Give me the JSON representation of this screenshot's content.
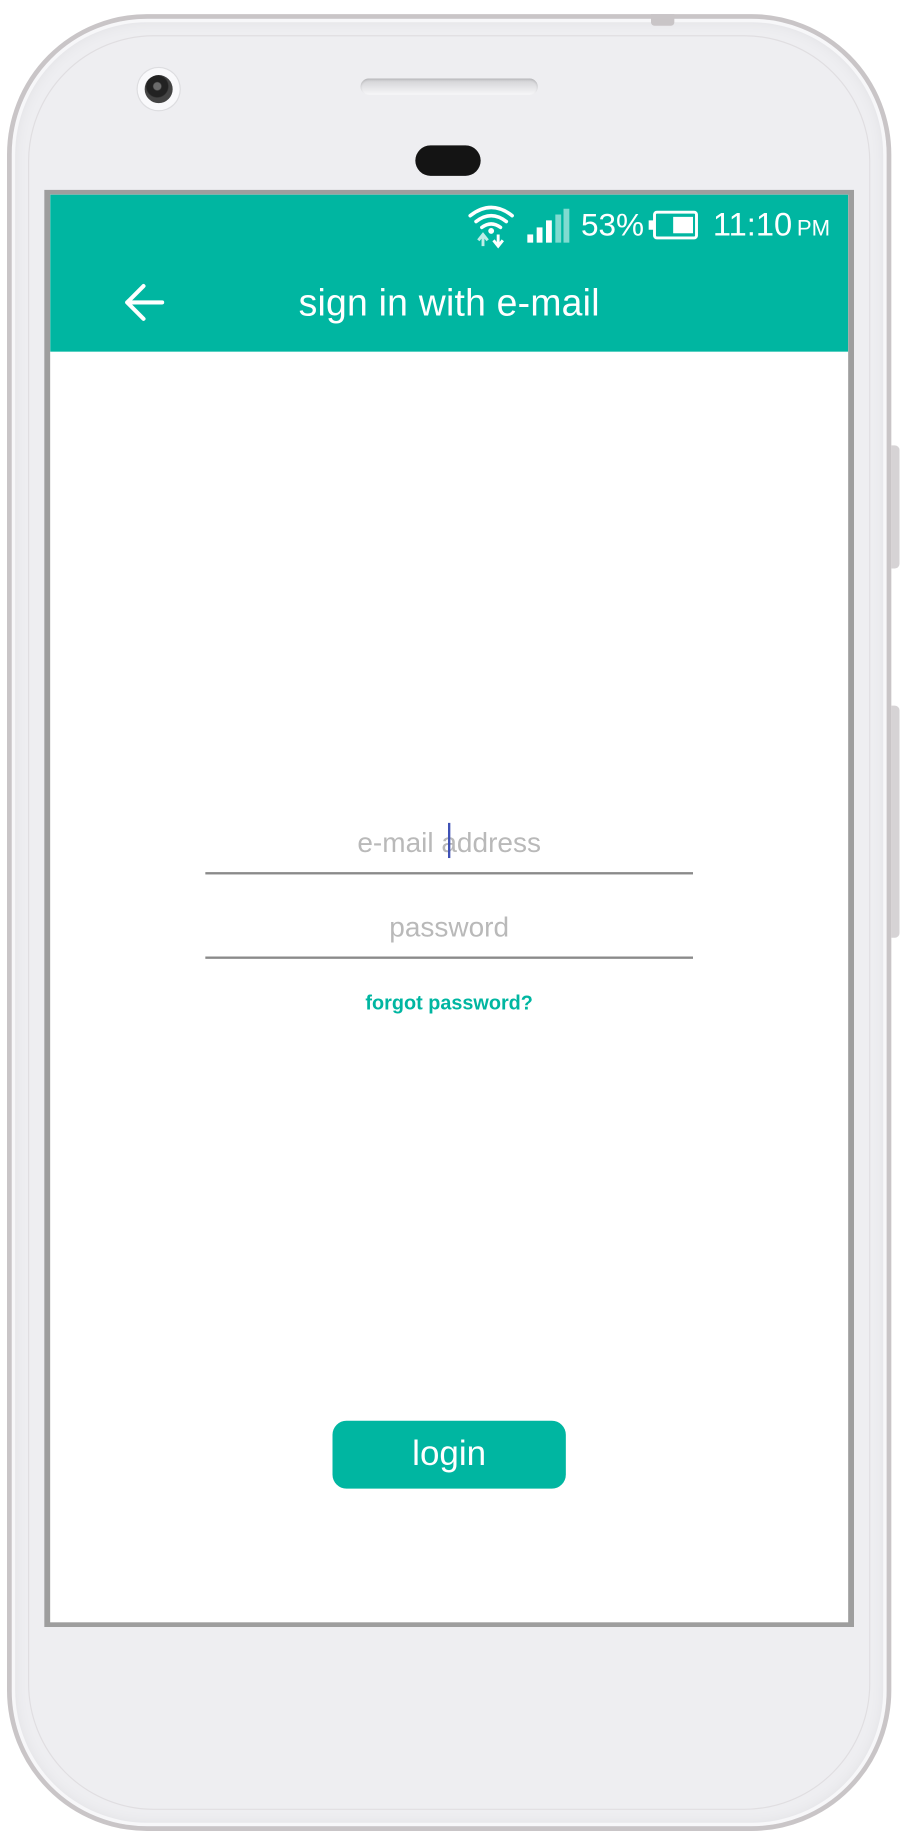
{
  "colors": {
    "accent": "#00b6a1",
    "placeholder": "#b9b9b9",
    "caret": "#3f51b5",
    "device_body": "#eeeef1"
  },
  "status_bar": {
    "wifi_icon": "wifi-icon",
    "signal_icon": "signal-icon",
    "battery_percent": "53%",
    "battery_icon": "battery-icon",
    "time": "11:10",
    "ampm": "PM"
  },
  "app_bar": {
    "back_icon": "arrow-left-icon",
    "title": "sign in with e-mail"
  },
  "form": {
    "email": {
      "placeholder": "e-mail address",
      "value": ""
    },
    "password": {
      "placeholder": "password",
      "value": ""
    },
    "forgot_label": "forgot password?"
  },
  "login_button": {
    "label": "login"
  }
}
